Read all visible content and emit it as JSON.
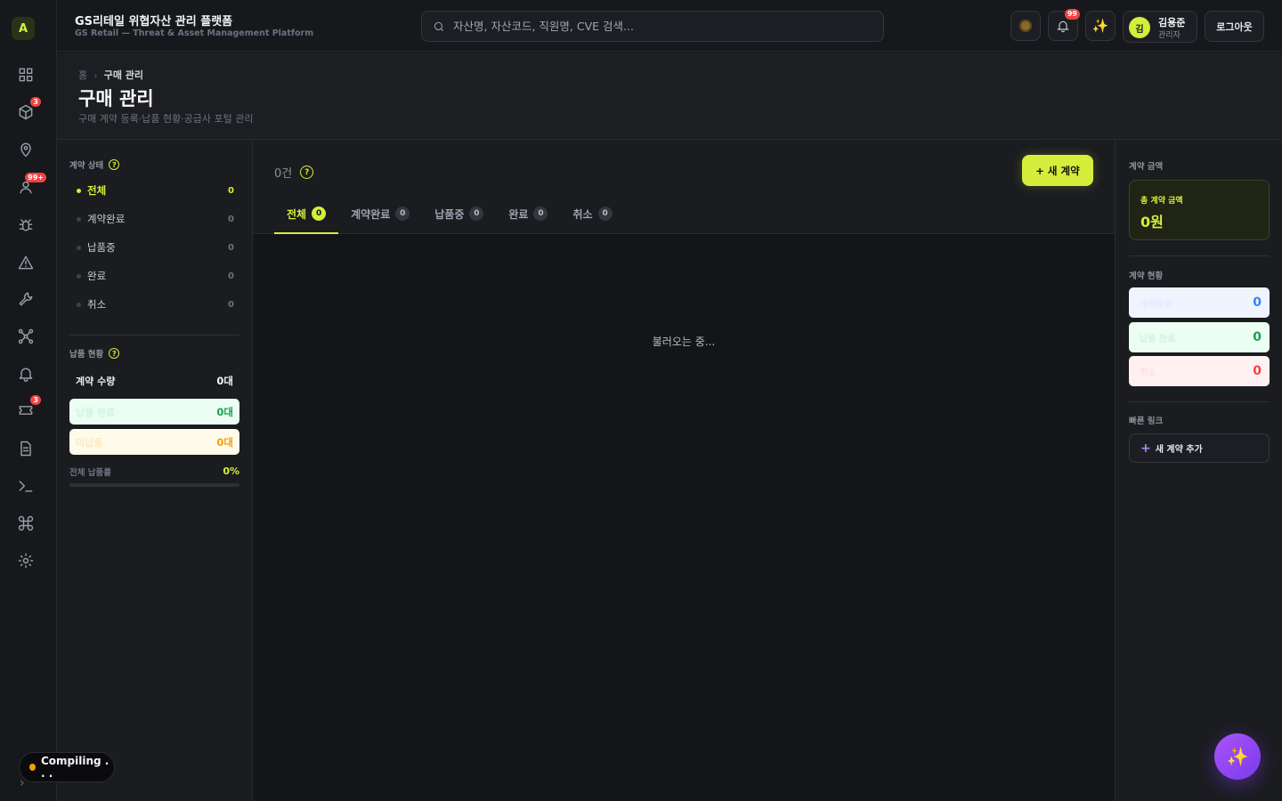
{
  "app": {
    "title": "GS리테일 위협자산 관리 플랫폼",
    "subtitle": "GS Retail — Threat & Asset Management Platform",
    "logo_letter": "A"
  },
  "sidebar": {
    "items": [
      {
        "icon": "grid-icon",
        "badge": ""
      },
      {
        "icon": "cube-icon",
        "badge": "3"
      },
      {
        "icon": "map-pin-icon",
        "badge": ""
      },
      {
        "icon": "users-icon",
        "badge": "99+"
      },
      {
        "icon": "bug-icon",
        "badge": ""
      },
      {
        "icon": "alert-triangle-icon",
        "badge": ""
      },
      {
        "icon": "wrench-icon",
        "badge": ""
      },
      {
        "icon": "network-icon",
        "badge": ""
      },
      {
        "icon": "bell-icon",
        "badge": ""
      },
      {
        "icon": "ticket-icon",
        "badge": "3"
      },
      {
        "icon": "document-icon",
        "badge": ""
      },
      {
        "icon": "terminal-icon",
        "badge": ""
      },
      {
        "icon": "command-icon",
        "badge": ""
      },
      {
        "icon": "settings-icon",
        "badge": ""
      }
    ],
    "collapse_glyph": "›"
  },
  "topbar": {
    "search_placeholder": "자산명, 자산코드, 직원명, CVE 검색...",
    "notification_badge": "99",
    "ai_glyph": "✨",
    "user": {
      "initial": "김",
      "name": "김용준",
      "role": "관리자"
    },
    "logout_label": "로그아웃"
  },
  "page": {
    "breadcrumb_home": "홈",
    "breadcrumb_sep": "›",
    "breadcrumb_current": "구매 관리",
    "title": "구매 관리",
    "description": "구매 계약 등록·납품 현황·공급사 포털 관리"
  },
  "filters": {
    "status_label": "계약 상태",
    "help_glyph": "?",
    "statuses": [
      {
        "label": "전체",
        "count": "0",
        "active": true
      },
      {
        "label": "계약완료",
        "count": "0",
        "active": false
      },
      {
        "label": "납품중",
        "count": "0",
        "active": false
      },
      {
        "label": "완료",
        "count": "0",
        "active": false
      },
      {
        "label": "취소",
        "count": "0",
        "active": false
      }
    ],
    "delivery_label": "납품 현황",
    "delivery": {
      "contract_qty_label": "계약 수량",
      "contract_qty": "0대",
      "delivered_label": "납품 완료",
      "delivered": "0대",
      "remaining_label": "미납품",
      "remaining": "0대",
      "rate_label": "전체 납품률",
      "rate": "0%",
      "rate_fraction": 0
    }
  },
  "main": {
    "count_text": "0건",
    "new_button": "+ 새 계약",
    "tabs": [
      {
        "label": "전체",
        "count": "0",
        "active": true
      },
      {
        "label": "계약완료",
        "count": "0",
        "active": false
      },
      {
        "label": "납품중",
        "count": "0",
        "active": false
      },
      {
        "label": "완료",
        "count": "0",
        "active": false
      },
      {
        "label": "취소",
        "count": "0",
        "active": false
      }
    ],
    "loading_text": "불러오는 중..."
  },
  "right": {
    "amount_section": "계약 금액",
    "total_amount_label": "총 계약 금액",
    "total_amount": "0원",
    "status_section": "계약 현황",
    "stats": [
      {
        "label": "계약완료",
        "value": "0"
      },
      {
        "label": "납품 완료",
        "value": "0"
      },
      {
        "label": "취소",
        "value": "0"
      }
    ],
    "quick_section": "빠른 링크",
    "quick_plus": "+",
    "quick_link": "새 계약 추가"
  },
  "floating": {
    "ai_glyph": "✨",
    "compiling": "Compiling . . ."
  },
  "colors": {
    "accent": "#d4ee3b",
    "background": "#141519",
    "danger": "#ef4444",
    "success": "#16a34a",
    "warning": "#f59e0b",
    "info": "#3b82f6",
    "ai": "#7c3aed"
  }
}
